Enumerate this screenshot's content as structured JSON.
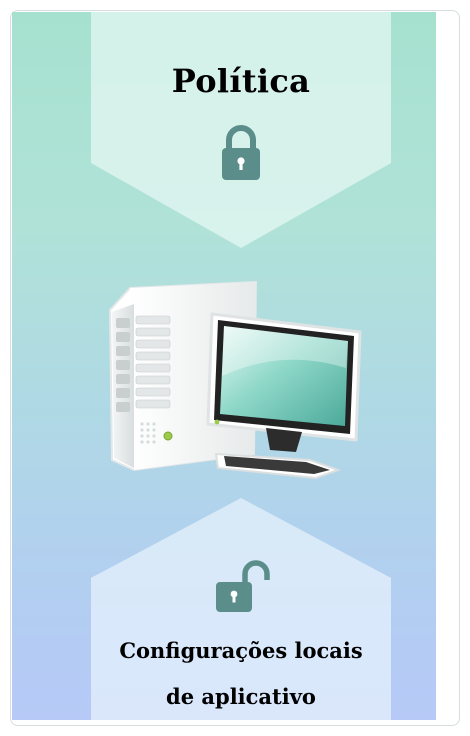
{
  "policy": {
    "title": "Política",
    "lock_icon": "lock-closed-icon"
  },
  "device": {
    "icon": "desktop-computer-icon"
  },
  "local": {
    "lock_icon": "lock-open-icon",
    "label_line1": "Configurações locais",
    "label_line2": "de aplicativo"
  },
  "colors": {
    "background_top": "#a6e1cf",
    "background_bottom": "#b6c9f7",
    "lock_color": "#5b8e8b"
  }
}
